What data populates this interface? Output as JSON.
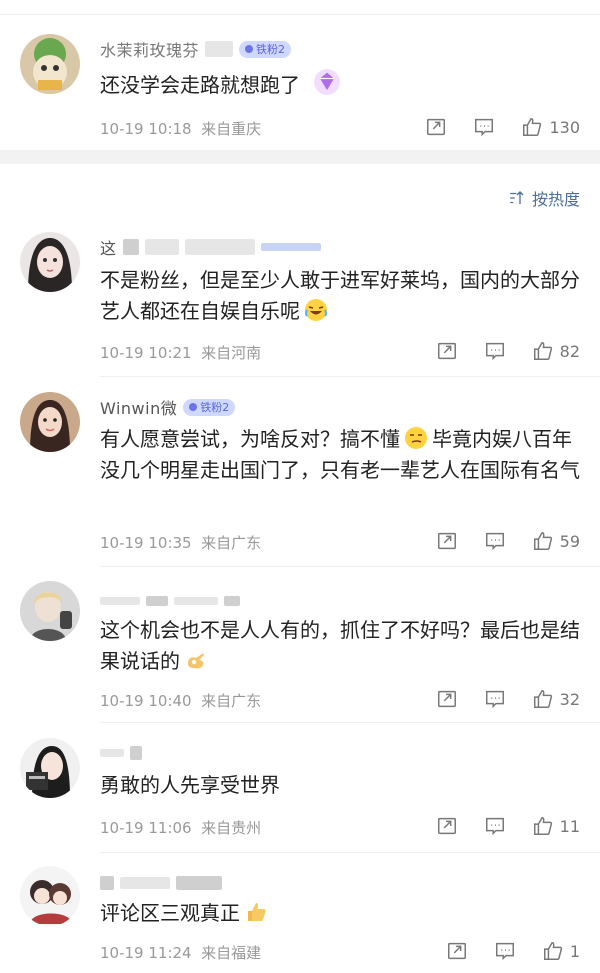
{
  "sort": {
    "label": "按热度",
    "icon": "sort-icon"
  },
  "comments": [
    {
      "name_visible": "水茉莉玫瑰芬",
      "badge": "铁粉2",
      "text": "还没学会走路就想跑了",
      "time": "10-19 10:18",
      "location": "来自重庆",
      "likes": "130",
      "avatar": "cat-avatar"
    },
    {
      "name_visible": "这",
      "badge": "",
      "text": "不是粉丝，但是至少人敢于进军好莱坞，国内的大部分艺人都还在自娱自乐呢",
      "time": "10-19 10:21",
      "location": "来自河南",
      "likes": "82",
      "avatar": "girl-avatar",
      "emoji": "laughing-crying-emoji"
    },
    {
      "name_visible": "Winwin微",
      "badge": "铁粉2",
      "text_a": "有人愿意尝试，为啥反对？搞不懂",
      "text_b": "毕竟内娱八百年没几个明星走出国门了，只有老一辈艺人在国际有名气",
      "time": "10-19 10:35",
      "location": "来自广东",
      "likes": "59",
      "avatar": "woman-avatar",
      "emoji": "smirk-emoji"
    },
    {
      "name_visible": "",
      "badge": "",
      "text": "这个机会也不是人人有的，抓住了不好吗？最后也是结果说话的",
      "time": "10-19 10:40",
      "location": "来自广东",
      "likes": "32",
      "avatar": "man-avatar",
      "emoji": "ok-hand-emoji"
    },
    {
      "name_visible": "",
      "badge": "",
      "text": "勇敢的人先享受世界",
      "time": "10-19 11:06",
      "location": "来自贵州",
      "likes": "11",
      "avatar": "lady-avatar"
    },
    {
      "name_visible": "",
      "badge": "",
      "text": "评论区三观真正",
      "time": "10-19 11:24",
      "location": "来自福建",
      "likes": "1",
      "avatar": "cartoon-avatar",
      "emoji": "thumbs-up-emoji"
    }
  ]
}
